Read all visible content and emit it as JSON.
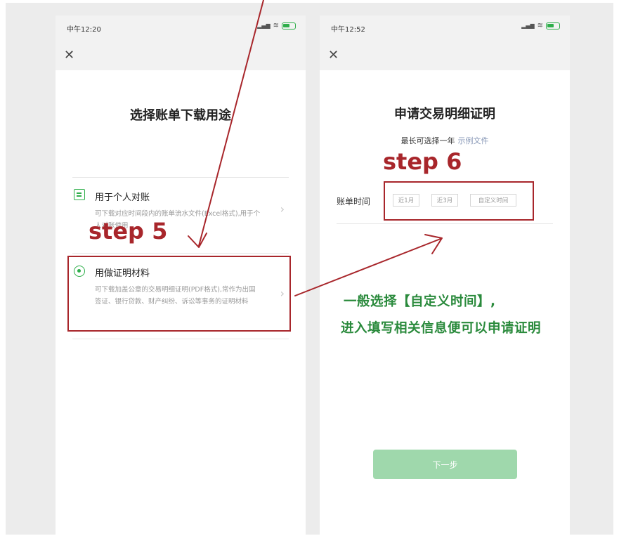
{
  "colors": {
    "accent_green": "#2eae4a",
    "annotation_red": "#a8262b",
    "note_green": "#2a8a3c"
  },
  "left_phone": {
    "status_time": "中午12:20",
    "title": "选择账单下载用途",
    "options": [
      {
        "icon": "document-check-icon",
        "title": "用于个人对账",
        "desc": "可下载对应时间段内的账单流水文件(Excel格式),用于个人对账使用"
      },
      {
        "icon": "radio-selected-icon",
        "title": "用做证明材料",
        "desc": "可下载加盖公章的交易明细证明(PDF格式),常作为出国签证、银行贷款、财产纠纷、诉讼等事务的证明材料"
      }
    ]
  },
  "right_phone": {
    "status_time": "中午12:52",
    "title": "申请交易明细证明",
    "subtitle": "最长可选择一年",
    "sample_link": "示例文件",
    "bill_time_label": "账单时间",
    "chips": [
      "近1月",
      "近3月",
      "自定义时间"
    ],
    "next_button": "下一步"
  },
  "annotations": {
    "step5": "step 5",
    "step6": "step 6",
    "note_line1": "一般选择【自定义时间】,",
    "note_line2": "进入填写相关信息便可以申请证明"
  }
}
